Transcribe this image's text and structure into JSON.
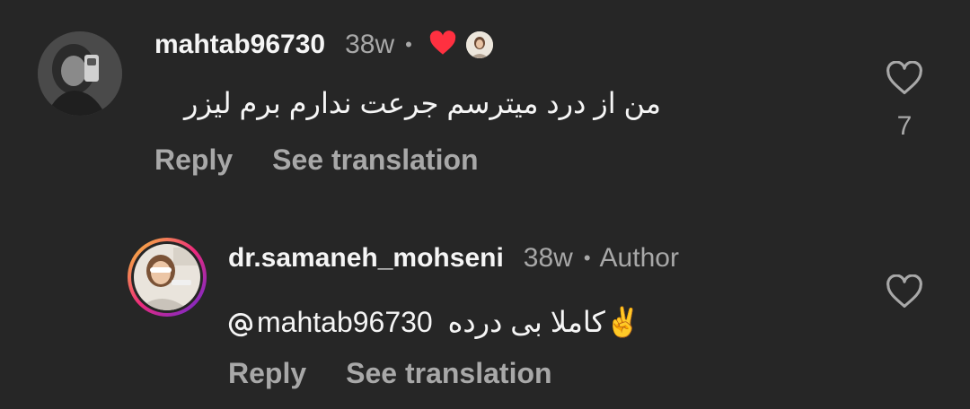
{
  "comments": [
    {
      "username": "mahtab96730",
      "time": "38w",
      "dot": "•",
      "text": "من از درد میترسم جرعت ندارم برم لیزر",
      "reply_label": "Reply",
      "translate_label": "See translation",
      "like_count": "7",
      "liked_by_author": true
    },
    {
      "username": "dr.samaneh_mohseni",
      "time": "38w",
      "dot": "•",
      "badge": "Author",
      "mention": "mahtab96730",
      "text": "کاملا بی درده",
      "emoji": "✌️",
      "reply_label": "Reply",
      "translate_label": "See translation"
    }
  ],
  "colors": {
    "background": "#262626",
    "text": "#f5f5f5",
    "muted": "#a8a8a8",
    "heart_red": "#ff3040"
  }
}
